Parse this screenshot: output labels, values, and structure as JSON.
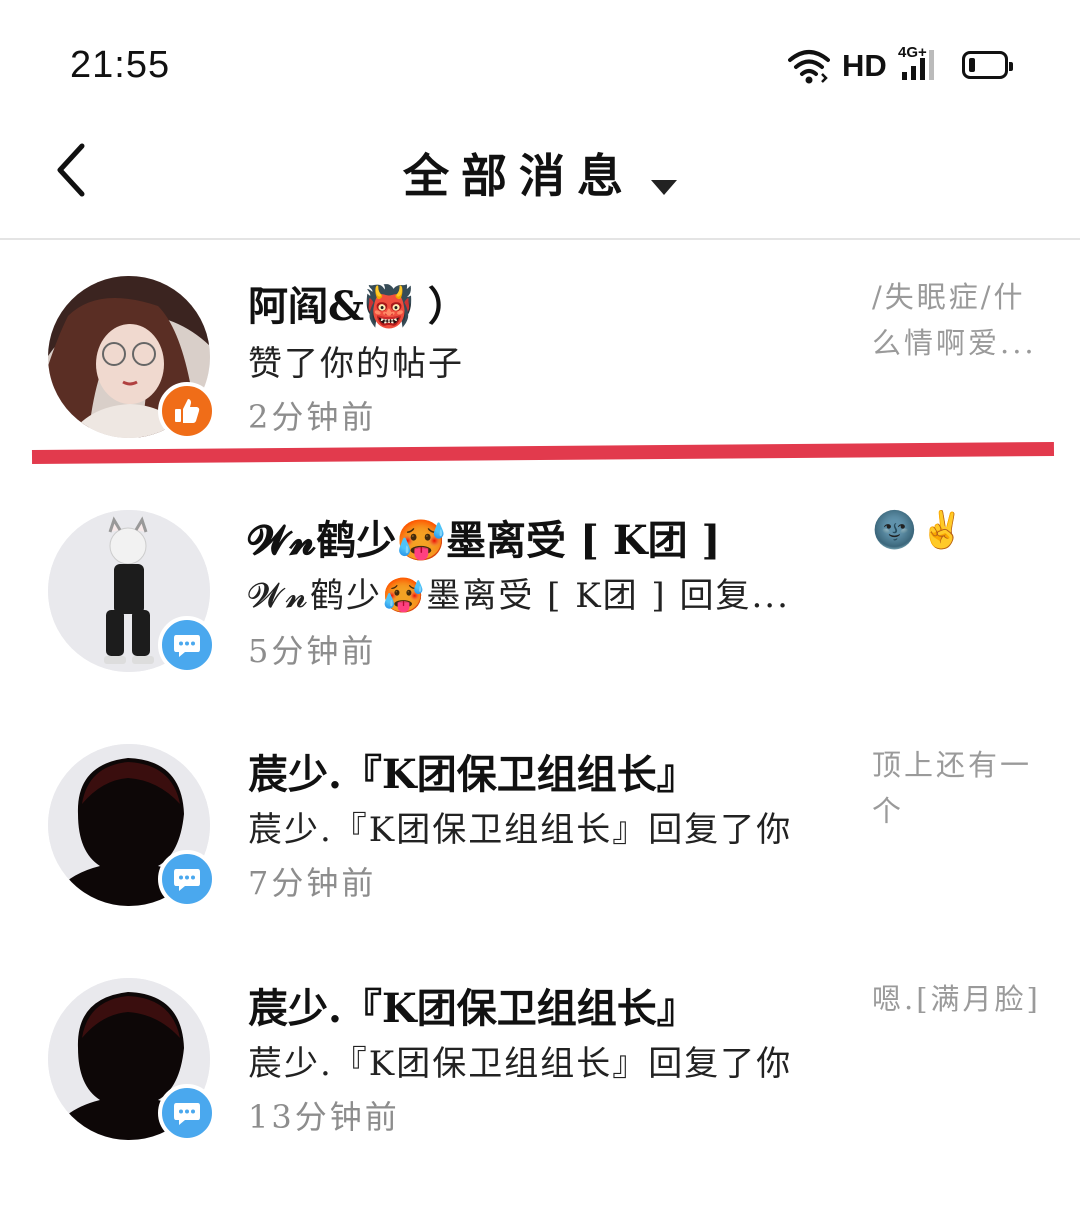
{
  "status_bar": {
    "time": "21:55",
    "wifi_icon": "wifi-icon",
    "hd_label": "HD",
    "network_label": "4G+",
    "battery_icon": "battery-icon"
  },
  "header": {
    "back_icon": "chevron-left-icon",
    "title": "全部消息",
    "dropdown_icon": "caret-down-icon"
  },
  "messages": [
    {
      "name": "阿阎&👹 ）",
      "action": "赞了你的帖子",
      "time": "2分钟前",
      "badge": "thumbs-up-icon",
      "badge_color": "#f06d18",
      "preview": "/失眠症/什么情啊爱..."
    },
    {
      "name": "𝓦𝓷鹤少🥵墨离受 [ K团 ]",
      "action": "𝓦𝓷鹤少🥵墨离受 [ K团 ] 回复...",
      "time": "5分钟前",
      "badge": "chat-bubble-icon",
      "badge_color": "#4aa8ee",
      "preview": "🌚✌️"
    },
    {
      "name": "莀少.『K团保卫组组长』",
      "action": "莀少.『K团保卫组组长』回复了你",
      "time": "7分钟前",
      "badge": "chat-bubble-icon",
      "badge_color": "#4aa8ee",
      "preview": "顶上还有一个"
    },
    {
      "name": "莀少.『K团保卫组组长』",
      "action": "莀少.『K团保卫组组长』回复了你",
      "time": "13分钟前",
      "badge": "chat-bubble-icon",
      "badge_color": "#4aa8ee",
      "preview": "嗯.[满月脸]"
    }
  ],
  "annotation": {
    "color": "#e23a4d"
  }
}
